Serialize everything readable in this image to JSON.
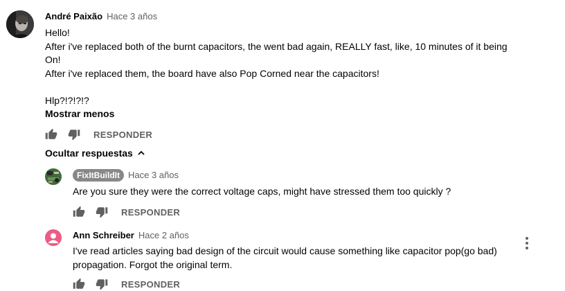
{
  "main_comment": {
    "author": "André Paixão",
    "time": "Hace 3 años",
    "text": "Hello!\nAfter i've replaced both of the burnt capacitors, the went bad again, REALLY fast, like, 10 minutes of it being On!\nAfter i've replaced them, the board have also Pop Corned near the capacitors!\n\nHlp?!?!?!?",
    "show_less_label": "Mostrar menos",
    "reply_label": "RESPONDER",
    "like_icon": "thumb-up-icon",
    "dislike_icon": "thumb-down-icon"
  },
  "replies_toggle": {
    "label": "Ocultar respuestas",
    "icon": "chevron-up-icon"
  },
  "replies": [
    {
      "author": "FixItBuildIt",
      "time": "Hace 3 años",
      "text": "Are you sure they were the correct voltage caps, might have stressed them too quickly ?",
      "reply_label": "RESPONDER"
    },
    {
      "author": "Ann Schreiber",
      "time": "Hace 2 años",
      "text": "I've read articles saying bad design of the circuit would cause something like capacitor pop(go bad) propagation. Forgot the original term.",
      "reply_label": "RESPONDER"
    }
  ],
  "colors": {
    "avatar_ann": "#ec5c85",
    "badge_bg": "#888888",
    "secondary_text": "#606060"
  }
}
